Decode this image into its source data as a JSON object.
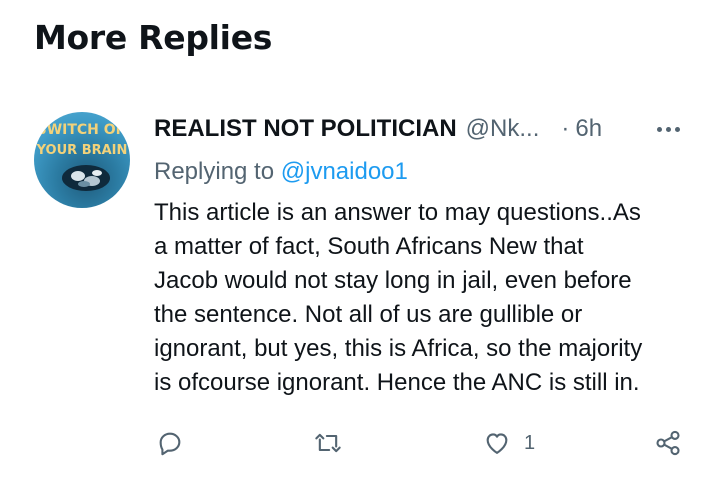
{
  "section": {
    "title": "More Replies"
  },
  "tweet": {
    "avatar_text_line1": "SWITCH ON",
    "avatar_text_line2": "YOUR BRAIN",
    "display_name": "REALIST NOT POLITICIAN",
    "handle": "@Nk...",
    "separator": "·",
    "time": "6h",
    "replying_prefix": "Replying to",
    "replying_handle": "@jvnaidoo1",
    "body_lines": [
      "This article is an answer to may questions..As",
      "a matter of fact, South Africans New that",
      "Jacob would not stay long in jail, even before",
      "the sentence. Not all of us are gullible or",
      "ignorant, but yes, this is Africa, so the majority",
      "is ofcourse ignorant. Hence the ANC is still in."
    ],
    "actions": {
      "reply_icon": "reply-icon",
      "retweet_icon": "retweet-icon",
      "like_icon": "heart-icon",
      "like_count": "1",
      "share_icon": "share-icon"
    }
  },
  "colors": {
    "text": "#0f1419",
    "secondary": "#536471",
    "link": "#1d9bf0"
  }
}
